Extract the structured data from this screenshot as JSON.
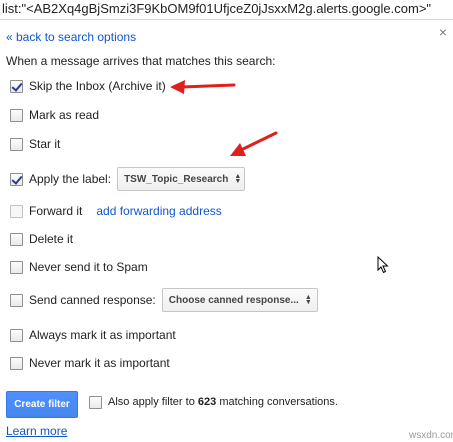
{
  "query": {
    "text": "list:\"<AB2Xq4gBjSmzi3F9KbOM9f01UfjceZ0jJsxxM2g.alerts.google.com>\""
  },
  "panel": {
    "back_link": "« back to search options",
    "close_glyph": "×",
    "intro": "When a message arrives that matches this search:"
  },
  "options": [
    {
      "label": "Skip the Inbox (Archive it)",
      "checked": true
    },
    {
      "label": "Mark as read",
      "checked": false
    },
    {
      "label": "Star it",
      "checked": false
    },
    {
      "label": "Apply the label:",
      "checked": true
    },
    {
      "label": "Forward it",
      "checked": false,
      "disabled": true
    },
    {
      "label": "Delete it",
      "checked": false
    },
    {
      "label": "Never send it to Spam",
      "checked": false
    },
    {
      "label": "Send canned response:",
      "checked": false
    },
    {
      "label": "Always mark it as important",
      "checked": false
    },
    {
      "label": "Never mark it as important",
      "checked": false
    }
  ],
  "label_select": {
    "value": "TSW_Topic_Research"
  },
  "forward_link": "add forwarding address",
  "canned_select": {
    "value": "Choose canned response..."
  },
  "actions": {
    "create_filter": "Create filter",
    "also_apply_prefix": "Also apply filter to",
    "also_apply_count": "623",
    "also_apply_suffix": "matching conversations."
  },
  "learn_more": "Learn more",
  "watermark": "wsxdn.com",
  "colors": {
    "link": "#1155cc",
    "button": "#4d90fe",
    "annotation_arrow": "#e0201b"
  },
  "icons": {
    "close": "close-icon",
    "select_arrows": "updown-arrows-icon",
    "cursor": "mouse-pointer-icon",
    "annotation": "red-arrow-icon"
  }
}
